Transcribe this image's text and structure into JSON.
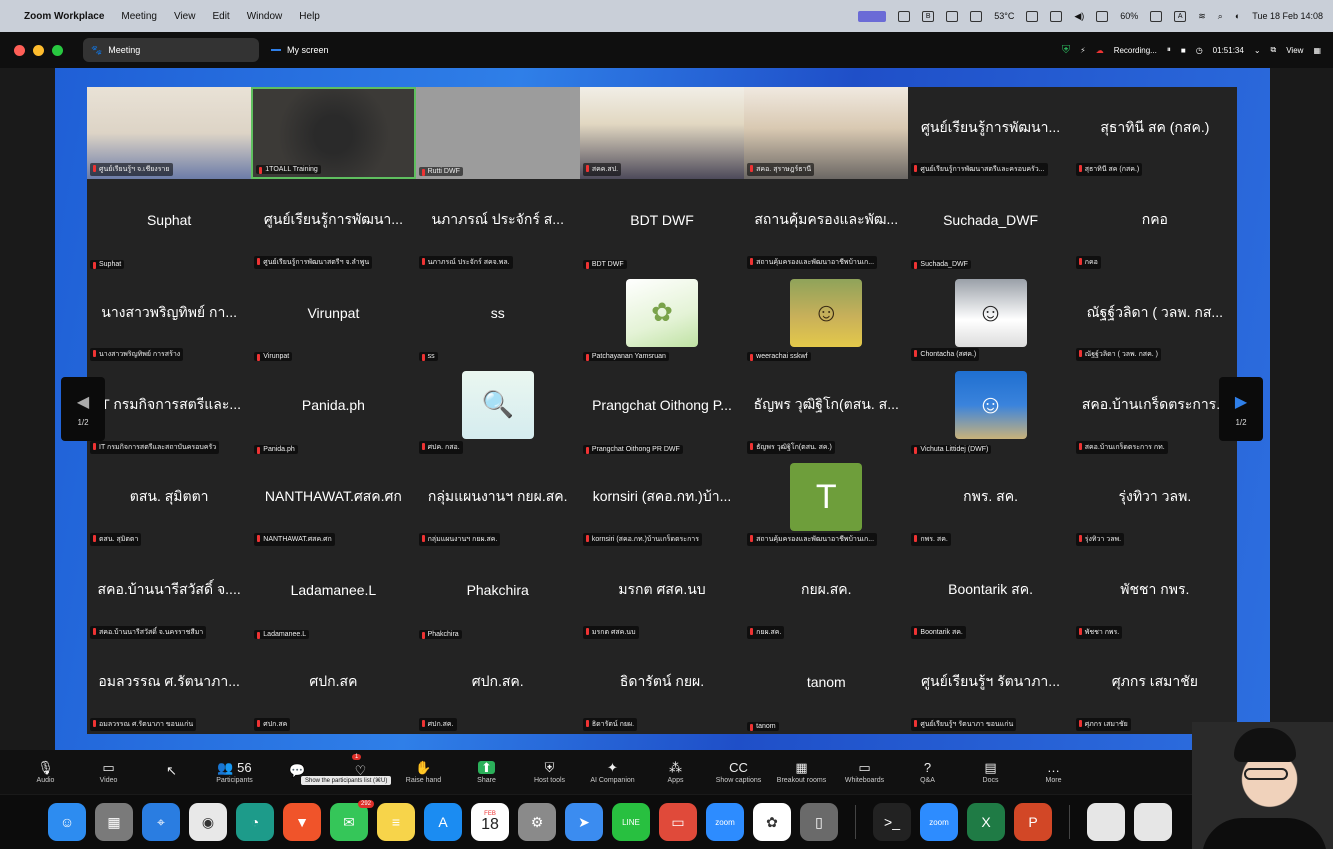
{
  "menubar": {
    "app": "Zoom Workplace",
    "items": [
      "Meeting",
      "View",
      "Edit",
      "Window",
      "Help"
    ],
    "temperature": "53°C",
    "battery": "60%",
    "clock": "Tue 18 Feb  14:08"
  },
  "titlebar": {
    "tab_meeting": "Meeting",
    "tab_myscreen": "My screen",
    "recording": "Recording...",
    "timer": "01:51:34",
    "view": "View"
  },
  "gallery": {
    "page_indicator": "1/2",
    "tiles": [
      {
        "name": "",
        "label": "ศูนย์เรียนรู้ฯ จ.เชียงราย",
        "kind": "video",
        "style": "v1"
      },
      {
        "name": "",
        "label": "1TOALL Training",
        "kind": "video",
        "style": "v2"
      },
      {
        "name": "",
        "label": "Rutti DWF",
        "kind": "video",
        "style": "v3"
      },
      {
        "name": "",
        "label": "สคค.สป.",
        "kind": "video",
        "style": "v4"
      },
      {
        "name": "",
        "label": "สคอ. สุราษฎร์ธานี",
        "kind": "video",
        "style": "v5"
      },
      {
        "name": "ศูนย์เรียนรู้การพัฒนา...",
        "label": "ศูนย์เรียนรู้การพัฒนาสตรีและครอบครัว..."
      },
      {
        "name": "สุธาทินี สค (กสค.)",
        "label": "สุธาทินี สค (กสค.)"
      },
      {
        "name": "Suphat",
        "label": "Suphat"
      },
      {
        "name": "ศูนย์เรียนรู้การพัฒนา...",
        "label": "ศูนย์เรียนรู้การพัฒนาสตรีฯ จ.ลำพูน"
      },
      {
        "name": "นภาภรณ์ ประจักร์ ส...",
        "label": "นภาภรณ์ ประจักร์ สคจ.พล."
      },
      {
        "name": "BDT DWF",
        "label": "BDT DWF"
      },
      {
        "name": "สถานคุ้มครองและพัฒ...",
        "label": "สถานคุ้มครองและพัฒนาอาชีพบ้านเก..."
      },
      {
        "name": "Suchada_DWF",
        "label": "Suchada_DWF"
      },
      {
        "name": "กคอ",
        "label": "กคอ"
      },
      {
        "name": "นางสาวพริญทิพย์ กา...",
        "label": "นางสาวพริญทิพย์ การสร้าง"
      },
      {
        "name": "Virunpat",
        "label": "Virunpat"
      },
      {
        "name": "ss",
        "label": "ss"
      },
      {
        "name": "",
        "label": "Patchayanan Yamsruan",
        "avatar": "av-fairy",
        "avatar_icon": "fairy-icon"
      },
      {
        "name": "",
        "label": "weerachai sskwf",
        "avatar": "av-man",
        "avatar_icon": "person-icon"
      },
      {
        "name": "",
        "label": "Chontacha (สศค.)",
        "avatar": "av-mask",
        "avatar_icon": "person-icon"
      },
      {
        "name": "ณัฐฐ์วลิดา ( วลพ. กส...",
        "label": "ณัฐฐ์วลิดา ( วลพ. กสค. )"
      },
      {
        "name": "IT กรมกิจการสตรีและ...",
        "label": "IT กรมกิจการสตรีและสถาบันครอบครัว"
      },
      {
        "name": "Panida.ph",
        "label": "Panida.ph"
      },
      {
        "name": "",
        "label": "ศปค. กสอ.",
        "avatar": "av-doc",
        "avatar_icon": "magnifier-icon"
      },
      {
        "name": "Prangchat Oithong P...",
        "label": "Prangchat Oithong PR DWF"
      },
      {
        "name": "ธัญพร วุฒิฐิโก(ตสน. ส...",
        "label": "ธัญพร วุฒิฐิโก(ตสน. สค.)"
      },
      {
        "name": "",
        "label": "Vichuta Littidej (DWF)",
        "avatar": "av-woman",
        "avatar_icon": "person-icon"
      },
      {
        "name": "สคอ.บ้านเกร็ดตระการ...",
        "label": "สคอ.บ้านเกร็ดตระการ กท."
      },
      {
        "name": "ตสน. สุมิตตา",
        "label": "ตสน. สุมิตตา"
      },
      {
        "name": "NANTHAWAT.ศสค.ศก",
        "label": "NANTHAWAT.ศสค.ศก"
      },
      {
        "name": "กลุ่มแผนงานฯ กยผ.สค.",
        "label": "กลุ่มแผนงานฯ กยผ.สค."
      },
      {
        "name": "kornsiri (สคอ.กท.)บ้า...",
        "label": "kornsiri (สคอ.กท.)บ้านเกร็ดตระการ"
      },
      {
        "name": "",
        "label": "สถานคุ้มครองและพัฒนาอาชีพบ้านเก...",
        "avatar": "av-T",
        "avatar_text": "T"
      },
      {
        "name": "กพร. สค.",
        "label": "กพร. สค."
      },
      {
        "name": "รุ่งทิวา วลพ.",
        "label": "รุ่งทิวา วลพ."
      },
      {
        "name": "สคอ.บ้านนารีสวัสดิ์ จ....",
        "label": "สคอ.บ้านนารีสวัสดิ์ จ.นครราชสีมา"
      },
      {
        "name": "Ladamanee.L",
        "label": "Ladamanee.L"
      },
      {
        "name": "Phakchira",
        "label": "Phakchira"
      },
      {
        "name": "มรกต ศสค.นบ",
        "label": "มรกต ศสค.นบ"
      },
      {
        "name": "กยผ.สค.",
        "label": "กยผ.สค."
      },
      {
        "name": "Boontarik สค.",
        "label": "Boontarik สค."
      },
      {
        "name": "พัชชา กพร.",
        "label": "พัชชา กพร."
      },
      {
        "name": "อมลวรรณ ศ.รัตนาภา...",
        "label": "อมลวรรณ ศ.รัตนาภา ขอนแก่น"
      },
      {
        "name": "ศปก.สค",
        "label": "ศปก.สค"
      },
      {
        "name": "ศปก.สค.",
        "label": "ศปก.สค."
      },
      {
        "name": "ธิดารัตน์ กยผ.",
        "label": "ธิดารัตน์ กยผ."
      },
      {
        "name": "tanom",
        "label": "tanom"
      },
      {
        "name": "ศูนย์เรียนรู้ฯ รัตนาภา...",
        "label": "ศูนย์เรียนรู้ฯ รัตนาภา ขอนแก่น"
      },
      {
        "name": "ศุภกร เสมาชัย",
        "label": "ศุภกร เสมาชัย"
      }
    ]
  },
  "toolbar": {
    "items": [
      {
        "label": "Audio",
        "icon": "microphone-icon",
        "glyph": "🎙"
      },
      {
        "label": "Video",
        "icon": "camera-icon",
        "glyph": "▭"
      },
      {
        "label": "",
        "icon": "pointer-icon",
        "glyph": "↖"
      },
      {
        "label": "Participants",
        "icon": "participants-icon",
        "glyph": "👥 56"
      },
      {
        "label": "",
        "icon": "chat-icon",
        "glyph": "💬"
      },
      {
        "label": "",
        "icon": "react-icon",
        "glyph": "♡"
      },
      {
        "label": "Raise hand",
        "icon": "hand-icon",
        "glyph": "✋"
      },
      {
        "label": "Share",
        "icon": "share-icon",
        "glyph": "⬆"
      },
      {
        "label": "Host tools",
        "icon": "shield-icon",
        "glyph": "⛨"
      },
      {
        "label": "AI Companion",
        "icon": "sparkle-icon",
        "glyph": "✦"
      },
      {
        "label": "Apps",
        "icon": "apps-icon",
        "glyph": "⁂"
      },
      {
        "label": "Show captions",
        "icon": "captions-icon",
        "glyph": "CC"
      },
      {
        "label": "Breakout rooms",
        "icon": "breakout-icon",
        "glyph": "▦"
      },
      {
        "label": "Whiteboards",
        "icon": "whiteboard-icon",
        "glyph": "▭"
      },
      {
        "label": "Q&A",
        "icon": "qa-icon",
        "glyph": "?"
      },
      {
        "label": "Docs",
        "icon": "docs-icon",
        "glyph": "▤"
      },
      {
        "label": "More",
        "icon": "more-icon",
        "glyph": "…"
      }
    ],
    "tooltip": "Show the participants list (⌘U)",
    "chat_badge": "1"
  },
  "dock": {
    "items": [
      {
        "name": "finder-icon",
        "bg": "#2d8cf0",
        "glyph": "☺"
      },
      {
        "name": "launchpad-icon",
        "bg": "#7a7a7a",
        "glyph": "▦"
      },
      {
        "name": "safari-icon",
        "bg": "#2a7de1",
        "glyph": "⌖"
      },
      {
        "name": "chrome-icon",
        "bg": "#e8e8e8",
        "glyph": "◉"
      },
      {
        "name": "edge-icon",
        "bg": "#1d9b8a",
        "glyph": "◔"
      },
      {
        "name": "brave-icon",
        "bg": "#f0542a",
        "glyph": "▼"
      },
      {
        "name": "messages-icon",
        "bg": "#35c659",
        "glyph": "✉",
        "badge": "292"
      },
      {
        "name": "notes-icon",
        "bg": "#f7d44a",
        "glyph": "≡"
      },
      {
        "name": "appstore-icon",
        "bg": "#1b8cf2",
        "glyph": "A"
      },
      {
        "name": "calendar-icon",
        "bg": "#ffffff",
        "glyph": "",
        "cal_month": "FEB",
        "cal_day": "18"
      },
      {
        "name": "settings-icon",
        "bg": "#8a8a8a",
        "glyph": "⚙"
      },
      {
        "name": "feedback-icon",
        "bg": "#3b8cf0",
        "glyph": "➤"
      },
      {
        "name": "line-icon",
        "bg": "#28c040",
        "glyph": "LINE"
      },
      {
        "name": "remote-desktop-icon",
        "bg": "#e04a3a",
        "glyph": "▭"
      },
      {
        "name": "zoom-app-icon",
        "bg": "#2d8cff",
        "glyph": "zoom"
      },
      {
        "name": "chatgpt-icon",
        "bg": "#ffffff",
        "glyph": "✿"
      },
      {
        "name": "preview-icon",
        "bg": "#6a6a6a",
        "glyph": "▯"
      },
      {
        "name": "terminal-icon",
        "bg": "#222222",
        "glyph": ">_"
      },
      {
        "name": "zoom-icon",
        "bg": "#2d8cff",
        "glyph": "zoom"
      },
      {
        "name": "excel-icon",
        "bg": "#1f7b45",
        "glyph": "X"
      },
      {
        "name": "powerpoint-icon",
        "bg": "#d24726",
        "glyph": "P"
      },
      {
        "name": "screenshot-thumb-1-icon",
        "bg": "#e6e6e6",
        "glyph": ""
      },
      {
        "name": "screenshot-thumb-2-icon",
        "bg": "#e6e6e6",
        "glyph": ""
      }
    ]
  },
  "colors": {
    "accent_blue": "#2f7fe8",
    "active_speaker_border": "#5fbf5f",
    "recording_red": "#e33"
  }
}
